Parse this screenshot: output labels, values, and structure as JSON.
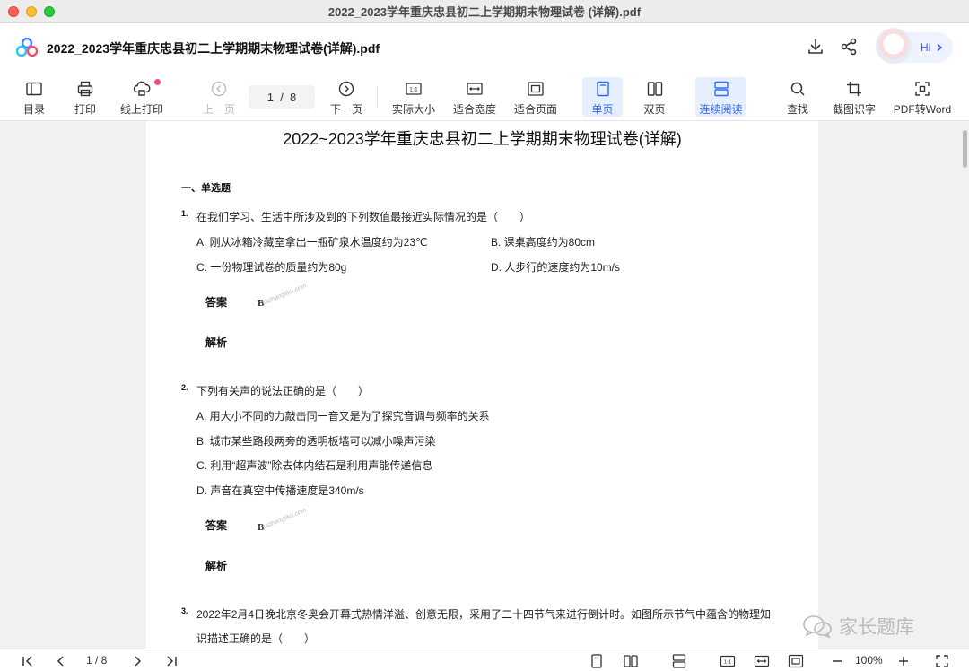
{
  "window": {
    "title": "2022_2023学年重庆忠县初二上学期期末物理试卷 (详解).pdf"
  },
  "header": {
    "doc_title": "2022_2023学年重庆忠县初二上学期期末物理试卷(详解).pdf",
    "hi_label": "Hi"
  },
  "toolbar": {
    "toc": "目录",
    "print": "打印",
    "online_print": "线上打印",
    "prev": "上一页",
    "page_value": "1  /  8",
    "next": "下一页",
    "actual_size": "实际大小",
    "fit_width": "适合宽度",
    "fit_page": "适合页面",
    "single": "单页",
    "double": "双页",
    "continuous": "连续阅读",
    "find": "查找",
    "ocr": "截图识字",
    "pdf_to_word": "PDF转Word"
  },
  "document": {
    "title": "2022~2023学年重庆忠县初二上学期期末物理试卷(详解)",
    "section": "一、单选题",
    "answer_label": "答案",
    "analysis_label": "解析",
    "watermark": "jiazhangtiku.com",
    "q1": {
      "num": "1.",
      "text": "在我们学习、生活中所涉及到的下列数值最接近实际情况的是（　　）",
      "a": "A. 刚从冰箱冷藏室拿出一瓶矿泉水温度约为23℃",
      "b": "B. 课桌高度约为80cm",
      "c": "C. 一份物理试卷的质量约为80g",
      "d": "D. 人步行的速度约为10m/s",
      "answer": "B"
    },
    "q2": {
      "num": "2.",
      "text": "下列有关声的说法正确的是（　　）",
      "a": "A. 用大小不同的力敲击同一音叉是为了探究音调与频率的关系",
      "b": "B. 城市某些路段两旁的透明板墙可以减小噪声污染",
      "c": "C. 利用“超声波”除去体内结石是利用声能传递信息",
      "d": "D. 声音在真空中传播速度是340m/s",
      "answer": "B"
    },
    "q3": {
      "num": "3.",
      "text_line1": "2022年2月4日晚北京冬奥会开幕式热情洋溢、创意无限，采用了二十四节气来进行倒计时。如图所示节气中蕴含的物理知",
      "text_line2": "识描述正确的是（　　）"
    }
  },
  "overlay": {
    "text": "家长题库"
  },
  "statusbar": {
    "page_value": "1 / 8",
    "zoom": "100%"
  }
}
